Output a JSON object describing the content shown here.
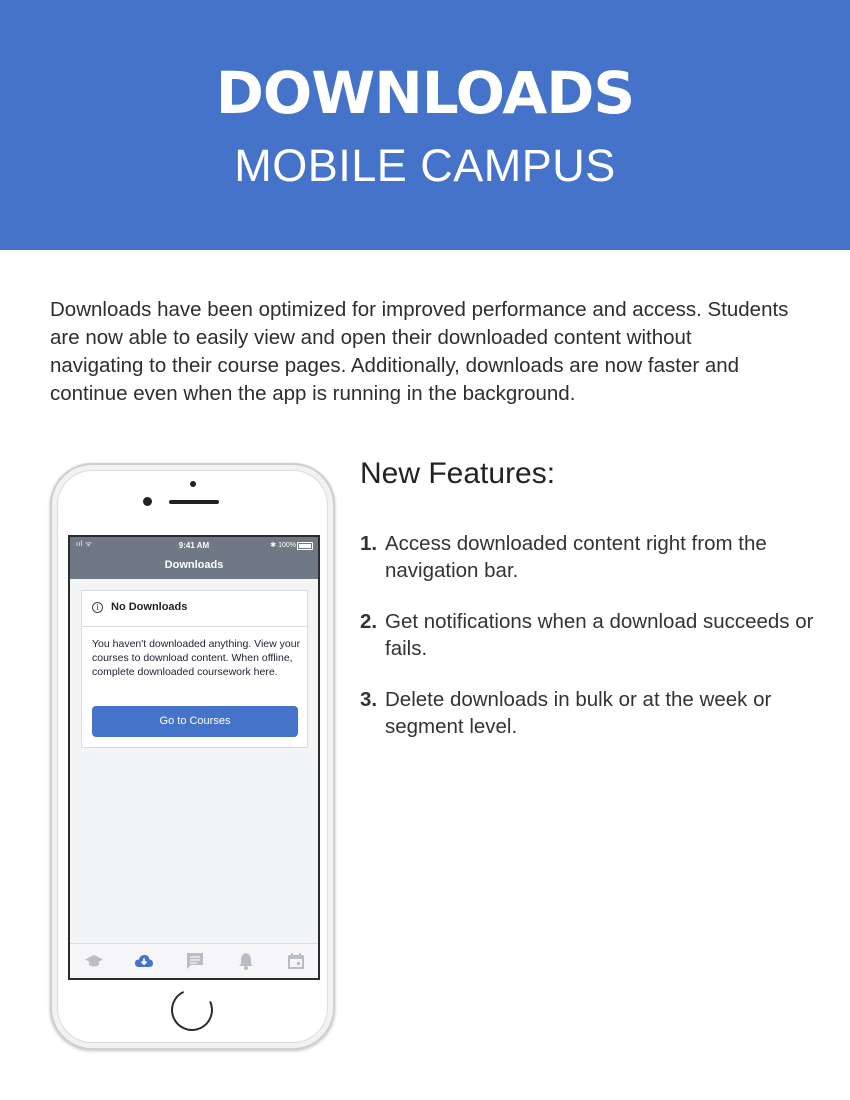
{
  "banner": {
    "title": "DOWNLOADS",
    "subtitle": "MOBILE CAMPUS",
    "background_color": "#4573c9"
  },
  "intro_text": "Downloads have been optimized for improved performance and access. Students are now able to easily view and open their downloaded content without navigating to their course pages. Additionally, downloads are now faster and continue even when the app is running in the background.",
  "phone": {
    "status_bar": {
      "signal": "ııl ᯤ",
      "time": "9:41 AM",
      "battery": "✱ 100%"
    },
    "nav_title": "Downloads",
    "card": {
      "title": "No Downloads",
      "info_icon": "i",
      "body": "You haven't downloaded anything. View your courses to download content. When offline, complete downloaded coursework here.",
      "button_label": "Go to Courses"
    },
    "tabs": [
      {
        "icon": "graduation-cap-icon",
        "active": false
      },
      {
        "icon": "cloud-download-icon",
        "active": true
      },
      {
        "icon": "message-icon",
        "active": false
      },
      {
        "icon": "bell-icon",
        "active": false
      },
      {
        "icon": "calendar-icon",
        "active": false
      }
    ],
    "accent_color": "#4573c9"
  },
  "features": {
    "title": "New Features:",
    "items": [
      {
        "number": "1.",
        "text": "Access downloaded content right from the navigation bar."
      },
      {
        "number": "2.",
        "text": "Get notifications when a download succeeds or fails."
      },
      {
        "number": "3.",
        "text": "Delete downloads in bulk or at the week or segment level."
      }
    ]
  }
}
